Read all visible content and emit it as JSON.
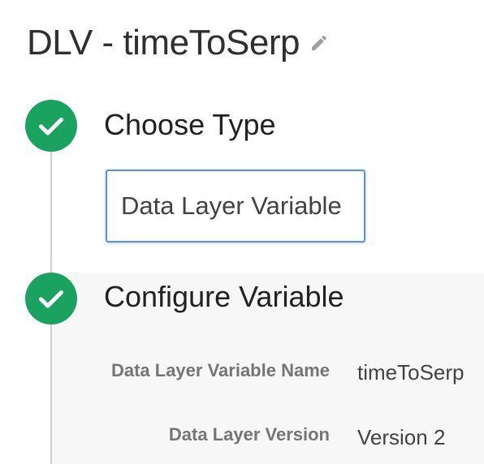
{
  "header": {
    "title": "DLV - timeToSerp",
    "edit_icon": "pencil-icon"
  },
  "steps": [
    {
      "title": "Choose Type",
      "status_icon": "check-circle-icon",
      "selected_type": "Data Layer Variable"
    },
    {
      "title": "Configure Variable",
      "status_icon": "check-circle-icon",
      "fields": [
        {
          "label": "Data Layer Variable Name",
          "value": "timeToSerp"
        },
        {
          "label": "Data Layer Version",
          "value": "Version 2"
        }
      ]
    }
  ],
  "colors": {
    "success_green": "#1aa260",
    "selection_blue": "#4d90fe",
    "panel_background": "#f7f7f7"
  }
}
